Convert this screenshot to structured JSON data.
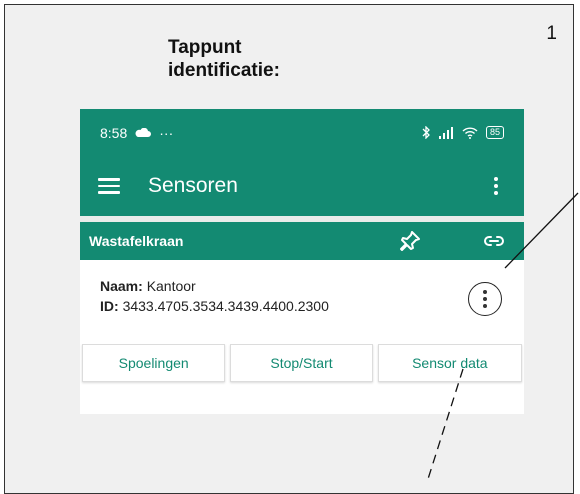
{
  "document": {
    "page_number": "1",
    "title_line1": "Tappunt",
    "title_line2": "identificatie:"
  },
  "statusbar": {
    "time": "8:58",
    "overflow": "···",
    "battery": "85"
  },
  "appbar": {
    "title": "Sensoren"
  },
  "sensor": {
    "name": "Wastafelkraan",
    "name_label": "Naam:",
    "name_value": "Kantoor",
    "id_label": "ID:",
    "id_value": "3433.4705.3534.3439.4400.2300"
  },
  "buttons": {
    "spoelingen": "Spoelingen",
    "stop_start": "Stop/Start",
    "sensor_data": "Sensor data"
  },
  "colors": {
    "primary": "#138a72",
    "frame_background": "#f0f0f0"
  },
  "icons": [
    "cloud-icon",
    "bluetooth-icon",
    "signal-icon",
    "wifi-icon",
    "battery-icon",
    "menu-icon",
    "more-vert-icon",
    "pin-icon",
    "link-icon"
  ]
}
